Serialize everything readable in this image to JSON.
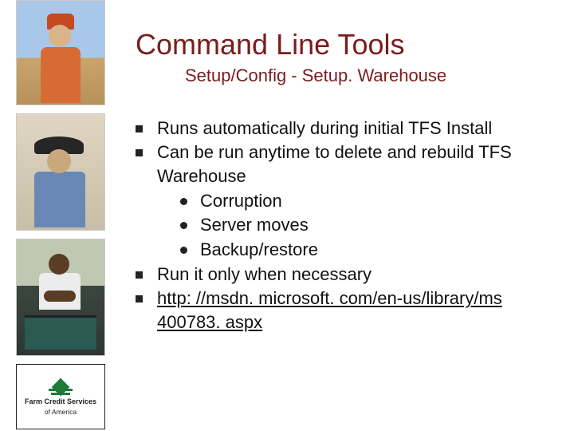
{
  "title": "Command Line Tools",
  "subtitle": "Setup/Config - Setup. Warehouse",
  "bullets": {
    "b1": "Runs automatically during initial TFS Install",
    "b2": "Can be run anytime to delete and rebuild TFS Warehouse",
    "b2_sub": {
      "s1": "Corruption",
      "s2": "Server moves",
      "s3": "Backup/restore"
    },
    "b3": "Run it only when necessary",
    "b4": "http: //msdn. microsoft. com/en-us/library/ms 400783. aspx"
  },
  "logo": {
    "line1": "Farm Credit Services",
    "line2": "of America"
  }
}
